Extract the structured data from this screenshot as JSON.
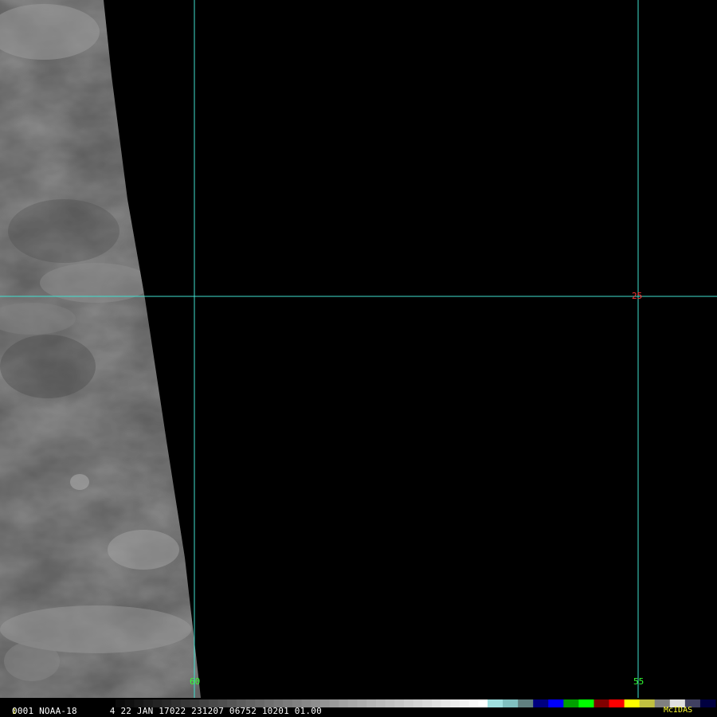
{
  "image": {
    "satellite": "NOAA-18",
    "frame_number": "1",
    "status_line": "0001 NOAA-18      4 22 JAN 17022 231207 06752 10201 01.00",
    "product_label": "McIDAS"
  },
  "grid": {
    "color": "#40e0d0",
    "meridians": [
      {
        "label": "60",
        "label_color": "#33ff33"
      },
      {
        "label": "55",
        "label_color": "#33ff33"
      }
    ],
    "parallels": [
      {
        "label": "25",
        "label_color": "#ff3333"
      }
    ]
  },
  "color_bar": {
    "segments": [
      "#000000",
      "#202020",
      "#404040",
      "#606060",
      "#808080",
      "#a0a0a0",
      "#c0c0c0",
      "#e0e0e0",
      "#ffffff",
      "#a0e0e0",
      "#80c0c0",
      "#608080",
      "#000080",
      "#0000ff",
      "#00a000",
      "#00ff00",
      "#800000",
      "#ff0000",
      "#ffff00",
      "#c0c040",
      "#808080",
      "#e0e0e0",
      "#404060",
      "#000040"
    ]
  }
}
